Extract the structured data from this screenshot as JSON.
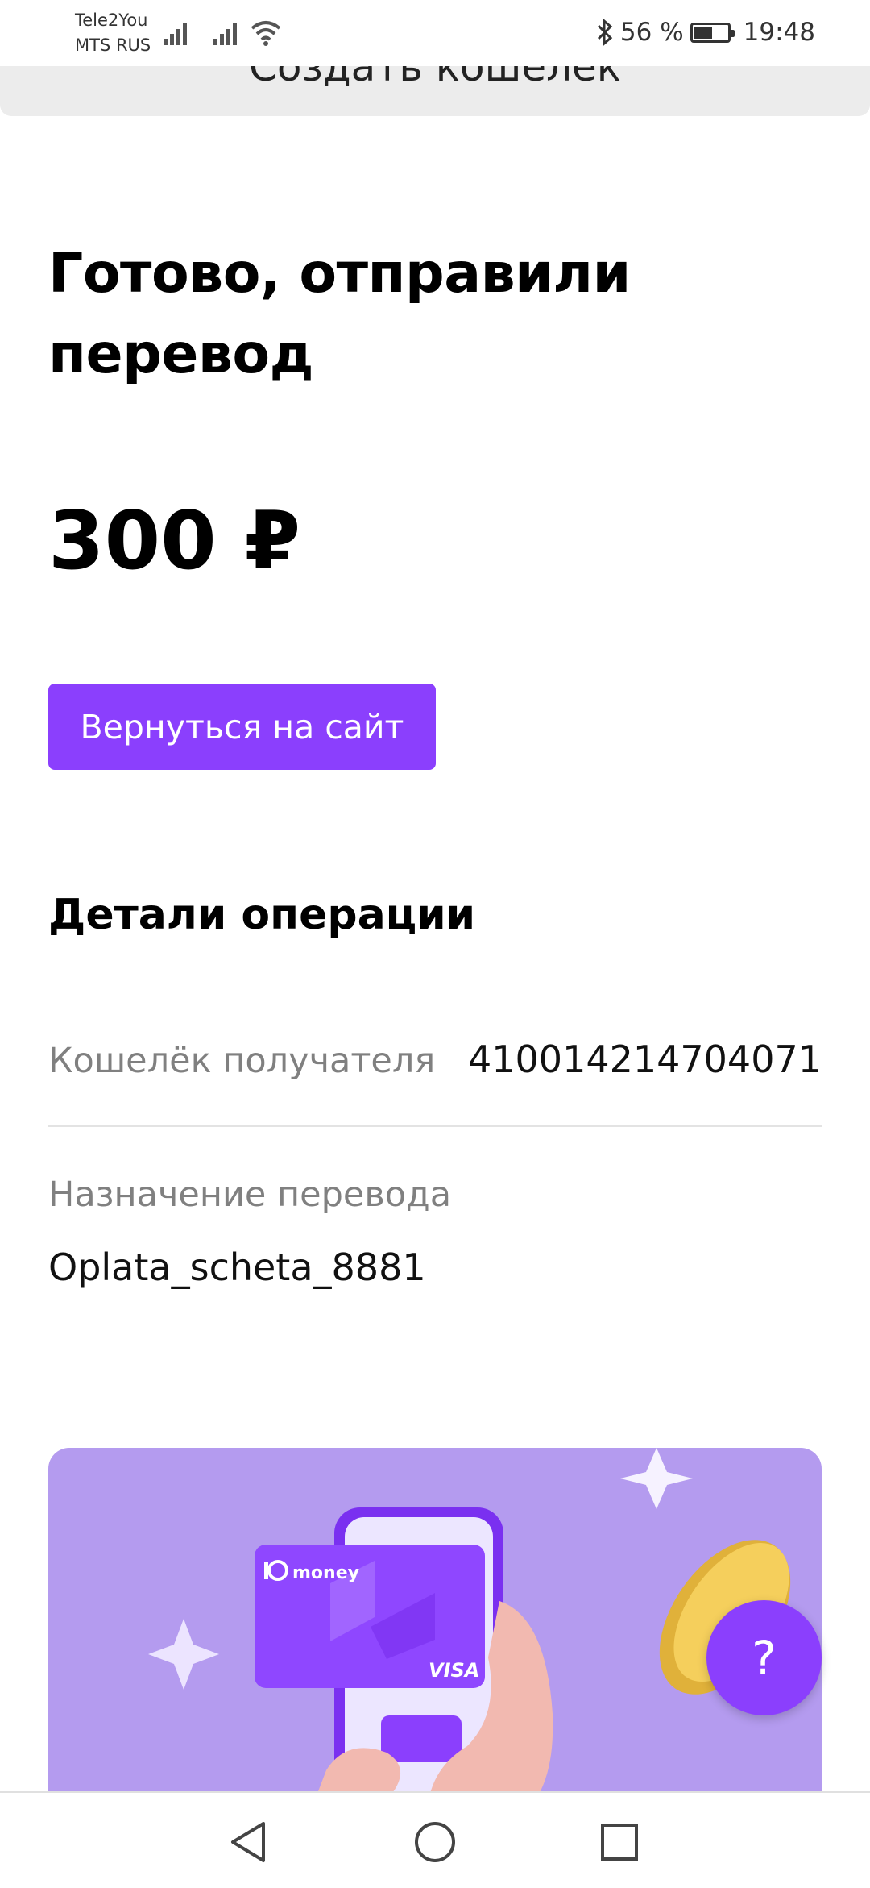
{
  "status_bar": {
    "carrier_1": "Tele2You",
    "carrier_2": "MTS RUS",
    "battery_percent": "56 %",
    "battery_level": 0.56,
    "time": "19:48"
  },
  "top_banner": {
    "label": "Создать кошелек"
  },
  "main": {
    "title": "Готово, отправили перевод",
    "amount": "300 ₽",
    "back_button": "Вернуться на сайт"
  },
  "details": {
    "title": "Детали операции",
    "recipient_wallet_label": "Кошелёк получателя",
    "recipient_wallet_value": "410014214704071",
    "purpose_label": "Назначение перевода",
    "purpose_value": "Oplata_scheta_8881"
  },
  "promo": {
    "card_brand": "money",
    "card_network": "VISA"
  },
  "help_button": "?",
  "colors": {
    "accent": "#8b3ffd",
    "promo_bg": "#b49bef"
  }
}
